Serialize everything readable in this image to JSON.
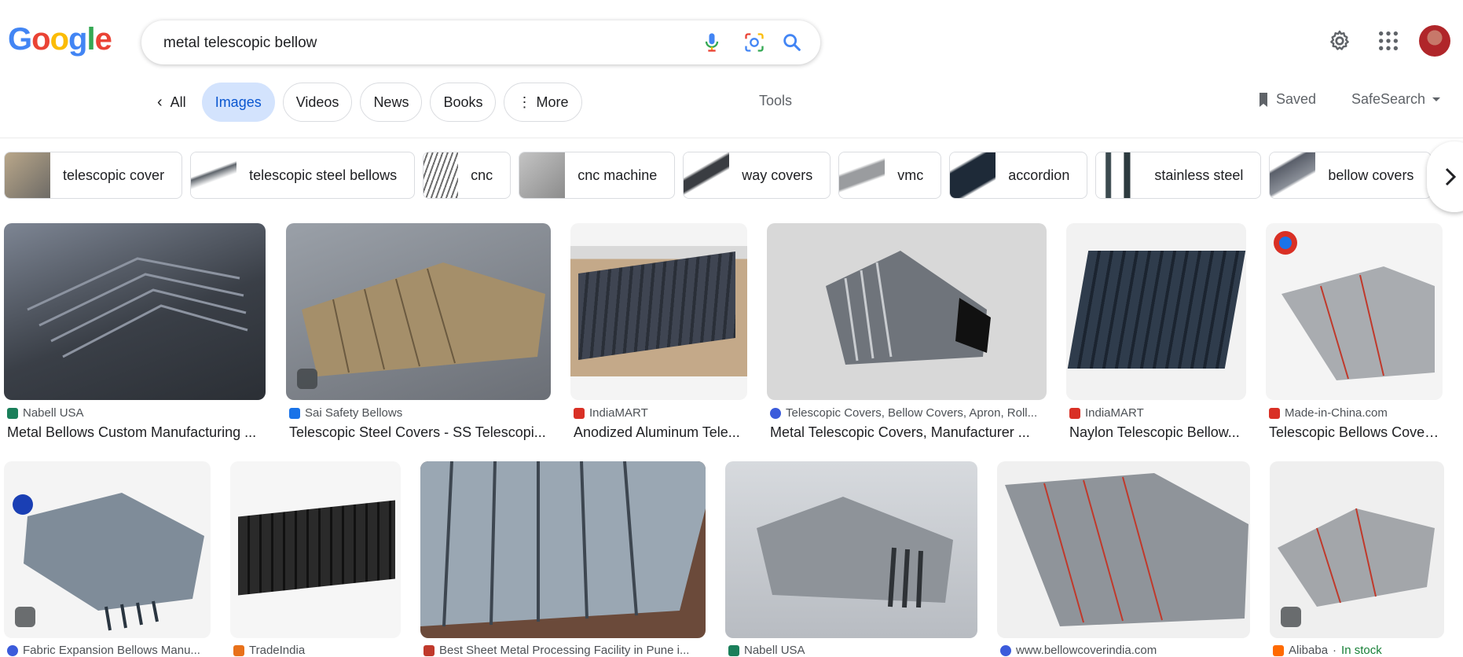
{
  "logo": {
    "letters": [
      "G",
      "o",
      "o",
      "g",
      "l",
      "e"
    ],
    "colors": [
      "#4285F4",
      "#EA4335",
      "#FBBC05",
      "#4285F4",
      "#34A853",
      "#EA4335"
    ]
  },
  "search": {
    "query": "metal telescopic bellow",
    "icons": [
      "microphone-icon",
      "camera-lens-icon",
      "search-icon"
    ]
  },
  "header_icons": [
    "gear-icon",
    "apps-grid-icon",
    "avatar"
  ],
  "tabs": [
    {
      "label": "All",
      "icon": "chevron-left-icon"
    },
    {
      "label": "Images",
      "active": true
    },
    {
      "label": "Videos"
    },
    {
      "label": "News"
    },
    {
      "label": "Books"
    },
    {
      "label": "More",
      "icon": "vertical-dots-icon"
    }
  ],
  "tools_label": "Tools",
  "saved_label": "Saved",
  "safesearch_label": "SafeSearch",
  "chips": [
    {
      "label": "telescopic cover"
    },
    {
      "label": "telescopic steel bellows"
    },
    {
      "label": "cnc"
    },
    {
      "label": "cnc machine"
    },
    {
      "label": "way covers"
    },
    {
      "label": "vmc"
    },
    {
      "label": "accordion"
    },
    {
      "label": "stainless steel"
    },
    {
      "label": "bellow covers"
    }
  ],
  "results_row1": [
    {
      "source": "Nabell USA",
      "title": "Metal Bellows Custom Manufacturing ...",
      "fav_color": "#1a7f5a",
      "img_bg": "#5a6270"
    },
    {
      "source": "Sai Safety Bellows",
      "title": "Telescopic Steel Covers - SS Telescopi...",
      "fav_color": "#1a73e8",
      "img_bg": "#8a8f96",
      "tag": true
    },
    {
      "source": "IndiaMART",
      "title": "Anodized Aluminum Tele...",
      "fav_color": "#d93025",
      "img_bg": "#c8b49a"
    },
    {
      "source": "Telescopic Covers, Bellow Covers, Apron, Roll...",
      "title": "Metal Telescopic Covers, Manufacturer ...",
      "fav_color": "#3b5bdb",
      "img_bg": "#d8d8d8"
    },
    {
      "source": "IndiaMART",
      "title": "Naylon Telescopic Bellow...",
      "fav_color": "#d93025",
      "img_bg": "#f2f2f2"
    },
    {
      "source": "Made-in-China.com",
      "title": "Telescopic Bellows Cover...",
      "fav_color": "#d93025",
      "img_bg": "#f4f4f4"
    }
  ],
  "results_row2": [
    {
      "source": "Fabric Expansion Bellows Manu...",
      "fav_color": "#3b5bdb",
      "img_bg": "#f4f4f4",
      "tag": true
    },
    {
      "source": "TradeIndia",
      "fav_color": "#e8711a",
      "img_bg": "#f6f6f6"
    },
    {
      "source": "Best Sheet Metal Processing Facility in Pune i...",
      "fav_color": "#c0392b",
      "img_bg": "#6b4a3a"
    },
    {
      "source": "Nabell USA",
      "fav_color": "#1a7f5a",
      "img_bg": "#c9ccd1"
    },
    {
      "source": "www.bellowcoverindia.com",
      "fav_color": "#3b5bdb",
      "img_bg": "#f0f0f0"
    },
    {
      "source": "Alibaba",
      "stock": "In stock",
      "fav_color": "#ff6a00",
      "img_bg": "#efefef",
      "tag": true
    }
  ]
}
